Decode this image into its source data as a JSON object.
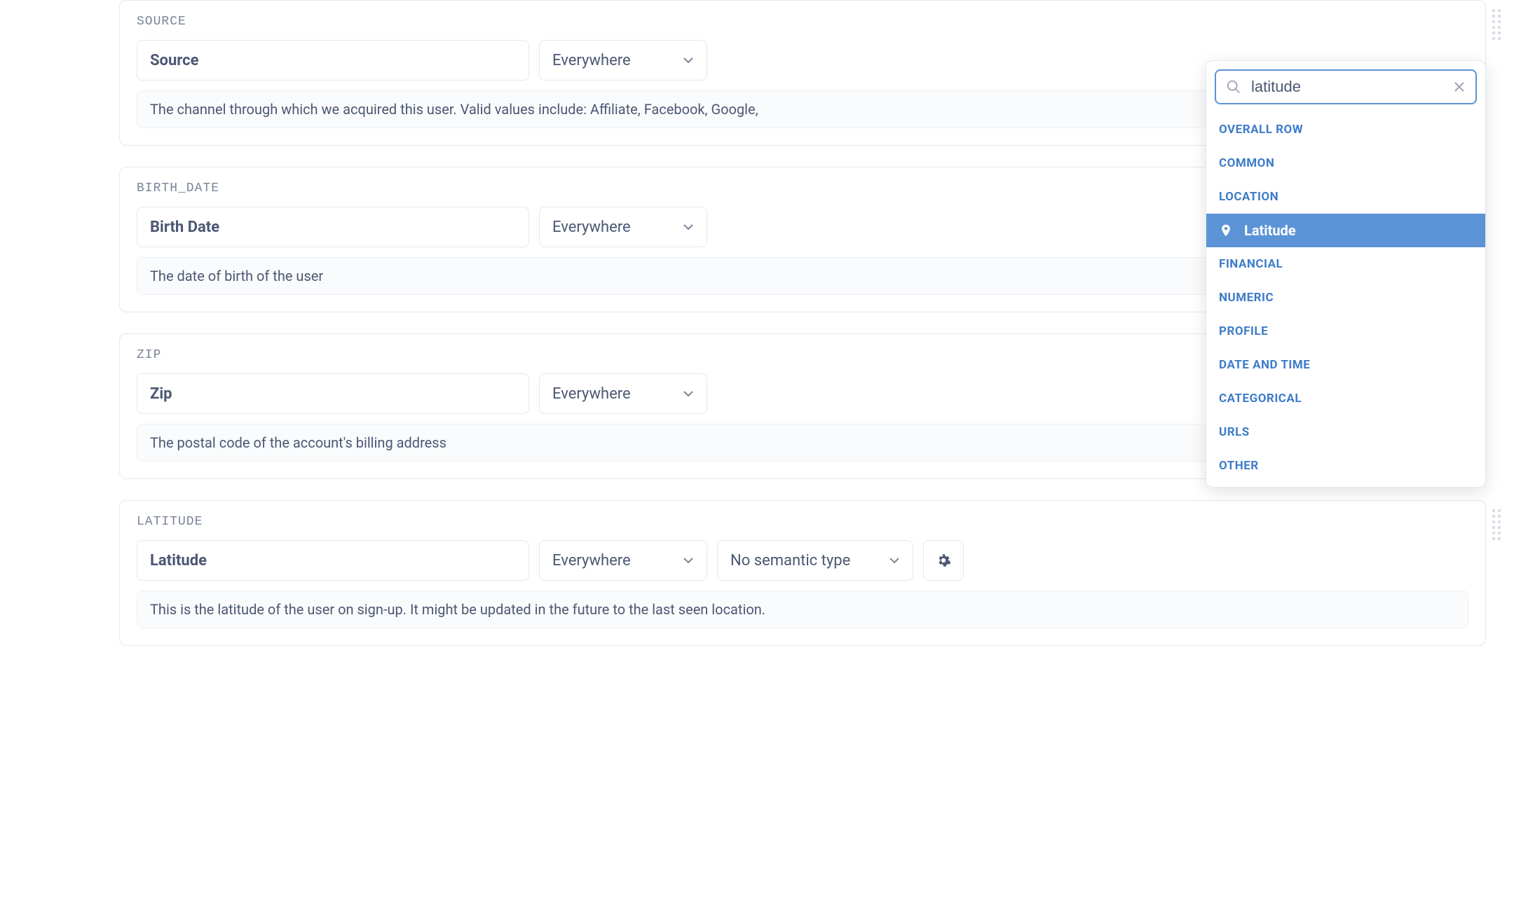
{
  "fields": [
    {
      "code": "SOURCE",
      "name": "Source",
      "visibility": "Everywhere",
      "semantic": "",
      "desc": "The channel through which we acquired this user. Valid values include: Affiliate, Facebook, Google, "
    },
    {
      "code": "BIRTH_DATE",
      "name": "Birth Date",
      "visibility": "Everywhere",
      "semantic": "",
      "desc": "The date of birth of the user"
    },
    {
      "code": "ZIP",
      "name": "Zip",
      "visibility": "Everywhere",
      "semantic": "",
      "desc": "The postal code of the account's billing address"
    },
    {
      "code": "LATITUDE",
      "name": "Latitude",
      "visibility": "Everywhere",
      "semantic": "No semantic type",
      "desc": "This is the latitude of the user on sign-up. It might be updated in the future to the last seen location."
    }
  ],
  "dropdown": {
    "search_value": "latitude",
    "categories": {
      "overall_row": "Overall Row",
      "common": "Common",
      "location": "Location",
      "financial": "Financial",
      "numeric": "Numeric",
      "profile": "Profile",
      "date_time": "Date and Time",
      "categorical": "Categorical",
      "urls": "URLs",
      "other": "Other"
    },
    "selected_item": "Latitude"
  }
}
